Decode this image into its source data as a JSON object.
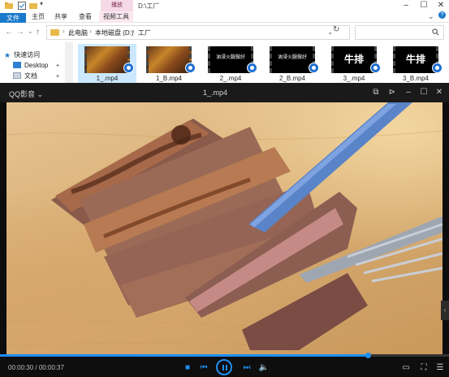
{
  "explorer": {
    "context_tab_head": "播放",
    "window_title": "D:\\工厂",
    "ribbon_tabs": [
      "文件",
      "主页",
      "共享",
      "查看",
      "视频工具"
    ],
    "path": [
      "此电脑",
      "本地磁盘 (D:)",
      "工厂"
    ],
    "nav_pane": [
      {
        "label": "快速访问",
        "icon": "star-icon"
      },
      {
        "label": "Desktop",
        "icon": "desktop-icon"
      },
      {
        "label": "文档",
        "icon": "document-icon"
      }
    ],
    "files": [
      {
        "name": "1_.mp4",
        "thumb": "food",
        "thumb_text": "",
        "selected": true
      },
      {
        "name": "1_B.mp4",
        "thumb": "food",
        "thumb_text": "",
        "selected": false
      },
      {
        "name": "2_.mp4",
        "thumb": "text",
        "thumb_text": "油浸火腿做好",
        "selected": false
      },
      {
        "name": "2_B.mp4",
        "thumb": "text",
        "thumb_text": "油浸火腿做好",
        "selected": false
      },
      {
        "name": "3_.mp4",
        "thumb": "big",
        "thumb_text": "牛排",
        "selected": false
      },
      {
        "name": "3_B.mp4",
        "thumb": "big",
        "thumb_text": "牛排",
        "selected": false
      }
    ]
  },
  "player": {
    "brand": "QQ影音",
    "file_name": "1_.mp4",
    "current_time": "00:00:30",
    "total_time": "00:00:37",
    "progress": 0.82,
    "accent": "#1e8ef2"
  }
}
